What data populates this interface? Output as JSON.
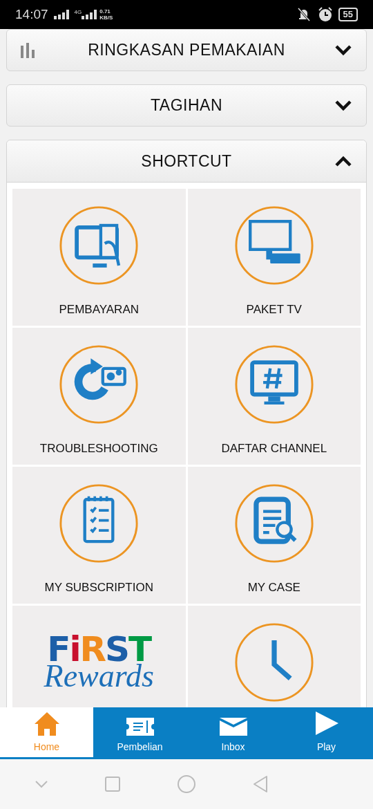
{
  "status_bar": {
    "time": "14:07",
    "network": "4G",
    "speed": "0.71",
    "speed_unit": "KB/S",
    "battery": "55"
  },
  "sections": [
    {
      "title": "RINGKASAN PEMAKAIAN",
      "expanded": false,
      "has_icon": true
    },
    {
      "title": "TAGIHAN",
      "expanded": false,
      "has_icon": false
    },
    {
      "title": "SHORTCUT",
      "expanded": true,
      "has_icon": false
    }
  ],
  "shortcuts": [
    {
      "kind": "icon",
      "label": "PEMBAYARAN"
    },
    {
      "kind": "icon",
      "label": "PAKET TV"
    },
    {
      "kind": "icon",
      "label": "TROUBLESHOOTING"
    },
    {
      "kind": "icon",
      "label": "DAFTAR CHANNEL"
    },
    {
      "kind": "icon",
      "label": "MY SUBSCRIPTION"
    },
    {
      "kind": "icon",
      "label": "MY CASE"
    },
    {
      "kind": "logo",
      "logo_letters": [
        {
          "text": "F",
          "color": "#1d5fa8"
        },
        {
          "text": "i",
          "color": "#c8102e"
        },
        {
          "text": "R",
          "color": "#f08c1e"
        },
        {
          "text": "S",
          "color": "#1d5fa8"
        },
        {
          "text": "T",
          "color": "#009a44"
        }
      ],
      "logo_script": "Rewards"
    },
    {
      "kind": "icon"
    }
  ],
  "bottom_nav": [
    {
      "label": "Home",
      "selected": true
    },
    {
      "label": "Pembelian",
      "selected": false
    },
    {
      "label": "Inbox",
      "selected": false
    },
    {
      "label": "Play",
      "selected": false
    }
  ]
}
